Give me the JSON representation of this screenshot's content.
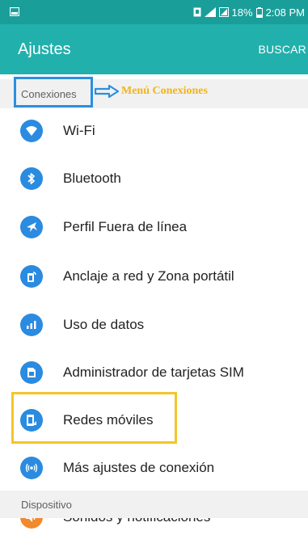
{
  "status_bar": {
    "battery": "18%",
    "time": "2:08 PM"
  },
  "header": {
    "title": "Ajustes",
    "search_label": "BUSCAR"
  },
  "sections": {
    "conexiones": "Conexiones",
    "dispositivo": "Dispositivo"
  },
  "annotation": {
    "label": "Menú Conexiones",
    "color_blue": "#2b8fe0",
    "color_yellow": "#f4c42a"
  },
  "items": [
    {
      "label": "Wi-Fi",
      "icon": "wifi-icon"
    },
    {
      "label": "Bluetooth",
      "icon": "bluetooth-icon"
    },
    {
      "label": "Perfil Fuera de línea",
      "icon": "airplane-icon"
    },
    {
      "label": "Anclaje a red y Zona portátil",
      "icon": "hotspot-icon"
    },
    {
      "label": "Uso de datos",
      "icon": "data-usage-icon"
    },
    {
      "label": "Administrador de tarjetas SIM",
      "icon": "sim-card-icon"
    },
    {
      "label": "Redes móviles",
      "icon": "mobile-networks-icon"
    },
    {
      "label": "Más ajustes de conexión",
      "icon": "more-connection-icon"
    },
    {
      "label": "Sonidos y notificaciones",
      "icon": "sound-icon"
    }
  ],
  "colors": {
    "status_bar": "#1a9e9a",
    "action_bar": "#22b0ac",
    "icon_blue": "#2a8be0",
    "icon_orange": "#f08a2a"
  }
}
